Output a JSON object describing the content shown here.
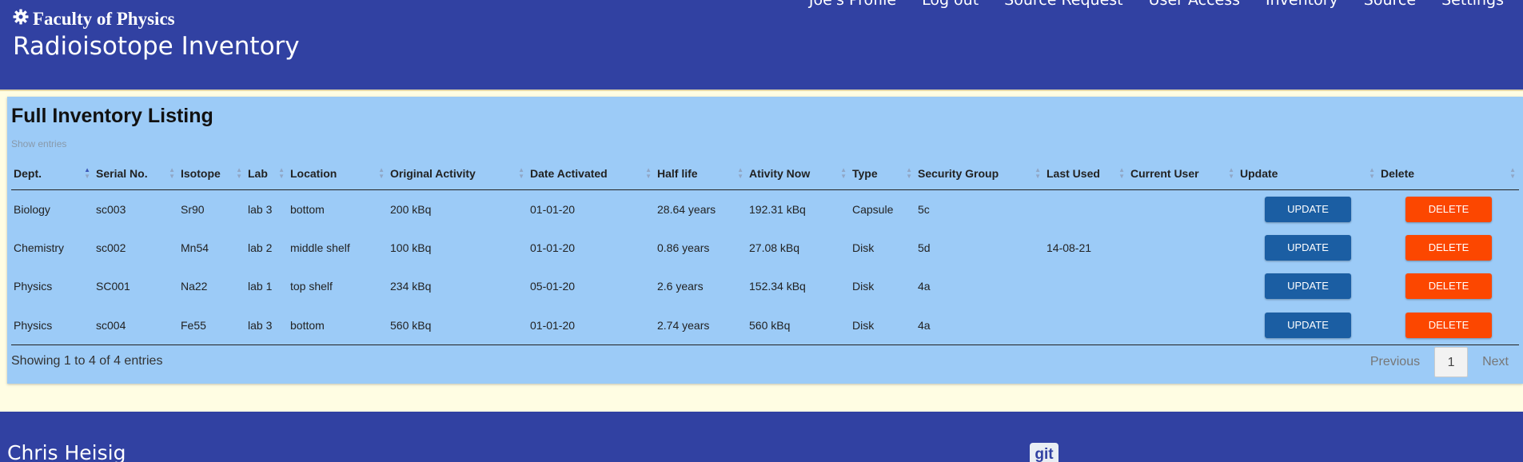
{
  "brand": {
    "title": "Faculty of Physics",
    "subtitle": "Radioisotope Inventory",
    "icon": "gear-icon"
  },
  "nav": [
    "Joe's Profile",
    "Log out",
    "Source Request",
    "User Access",
    "Inventory",
    "Source",
    "Settings"
  ],
  "panel": {
    "title": "Full Inventory Listing",
    "show_entries": "Show entries"
  },
  "table": {
    "columns": [
      "Dept.",
      "Serial No.",
      "Isotope",
      "Lab",
      "Location",
      "Original Activity",
      "Date Activated",
      "Half life",
      "Ativity Now",
      "Type",
      "Security Group",
      "Last Used",
      "Current User",
      "Update",
      "Delete"
    ],
    "rows": [
      [
        "Biology",
        "sc003",
        "Sr90",
        "lab 3",
        "bottom",
        "200 kBq",
        "01-01-20",
        "28.64 years",
        "192.31 kBq",
        "Capsule",
        "5c",
        "",
        ""
      ],
      [
        "Chemistry",
        "sc002",
        "Mn54",
        "lab 2",
        "middle shelf",
        "100 kBq",
        "01-01-20",
        "0.86 years",
        "27.08 kBq",
        "Disk",
        "5d",
        "14-08-21",
        ""
      ],
      [
        "Physics",
        "SC001",
        "Na22",
        "lab 1",
        "top shelf",
        "234 kBq",
        "05-01-20",
        "2.6 years",
        "152.34 kBq",
        "Disk",
        "4a",
        "",
        ""
      ],
      [
        "Physics",
        "sc004",
        "Fe55",
        "lab 3",
        "bottom",
        "560 kBq",
        "01-01-20",
        "2.74 years",
        "560 kBq",
        "Disk",
        "4a",
        "",
        ""
      ]
    ],
    "update_label": "UPDATE",
    "delete_label": "DELETE"
  },
  "info": "Showing 1 to 4 of 4 entries",
  "pager": {
    "previous": "Previous",
    "page": "1",
    "next": "Next"
  },
  "footer": {
    "name": "Chris Heisig",
    "git": "git"
  },
  "colors": {
    "header": "#3141a2",
    "panel": "#9ccbf7",
    "update": "#1b5ea3",
    "delete": "#fc4700",
    "background": "#fffde3"
  }
}
